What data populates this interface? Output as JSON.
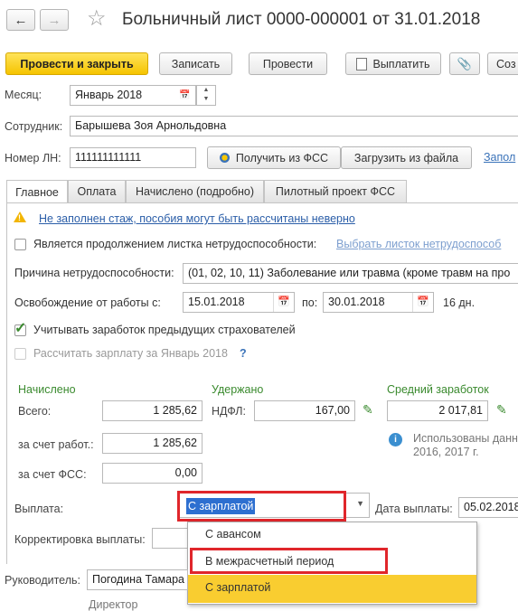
{
  "nav": {
    "back_icon": "arrow-left",
    "forward_icon": "arrow-right",
    "star_icon": "star"
  },
  "title": "Больничный лист 0000-000001 от 31.01.2018",
  "toolbar": {
    "post_close": "Провести и закрыть",
    "save": "Записать",
    "post": "Провести",
    "pay": "Выплатить",
    "clip_icon": "paperclip",
    "create": "Соз"
  },
  "fields": {
    "month_label": "Месяц:",
    "month_value": "Январь 2018",
    "employee_label": "Сотрудник:",
    "employee_value": "Барышева Зоя Арнольдовна",
    "ln_label": "Номер ЛН:",
    "ln_value": "111111111111",
    "get_fss": "Получить из ФСС",
    "load_file": "Загрузить из файла",
    "fill_link": "Запол"
  },
  "tabs": [
    "Главное",
    "Оплата",
    "Начислено (подробно)",
    "Пилотный проект ФСС"
  ],
  "main": {
    "warning": "Не заполнен стаж, пособия могут быть рассчитаны неверно",
    "continuation_label": "Является продолжением листка нетрудоспособности:",
    "choose_sheet_link": "Выбрать листок нетрудоспособ",
    "reason_label": "Причина нетрудоспособности:",
    "reason_value": "(01, 02, 10, 11) Заболевание или травма (кроме травм на про",
    "release_label": "Освобождение от работы с:",
    "release_from": "15.01.2018",
    "to_label": "по:",
    "release_to": "30.01.2018",
    "days": "16 дн.",
    "consider_label": "Учитывать заработок предыдущих страхователей",
    "calc_salary_label": "Рассчитать зарплату за Январь 2018",
    "help": "?"
  },
  "amounts": {
    "accrued_header": "Начислено",
    "withheld_header": "Удержано",
    "avg_header": "Средний заработок",
    "total_label": "Всего:",
    "total_value": "1 285,62",
    "ndfl_label": "НДФЛ:",
    "ndfl_value": "167,00",
    "avg_value": "2 017,81",
    "employer_label": "за счет работ.:",
    "employer_value": "1 285,62",
    "fss_label": "за счет ФСС:",
    "fss_value": "0,00",
    "info_text_1": "Использованы данн",
    "info_text_2": "2016,  2017 г."
  },
  "payout": {
    "label": "Выплата:",
    "value": "С зарплатой",
    "date_label": "Дата выплаты:",
    "date_value": "05.02.2018",
    "correction_label": "Корректировка выплаты:",
    "options": [
      "С авансом",
      "В межрасчетный период",
      "С зарплатой"
    ]
  },
  "footer": {
    "head_label": "Руководитель:",
    "head_value": "Погодина Тамара",
    "position": "Директор"
  },
  "colors": {
    "accent_yellow": "#f5c400",
    "highlight_red": "#e0262b",
    "link_blue": "#3b73b9",
    "green": "#3a8a2e"
  }
}
